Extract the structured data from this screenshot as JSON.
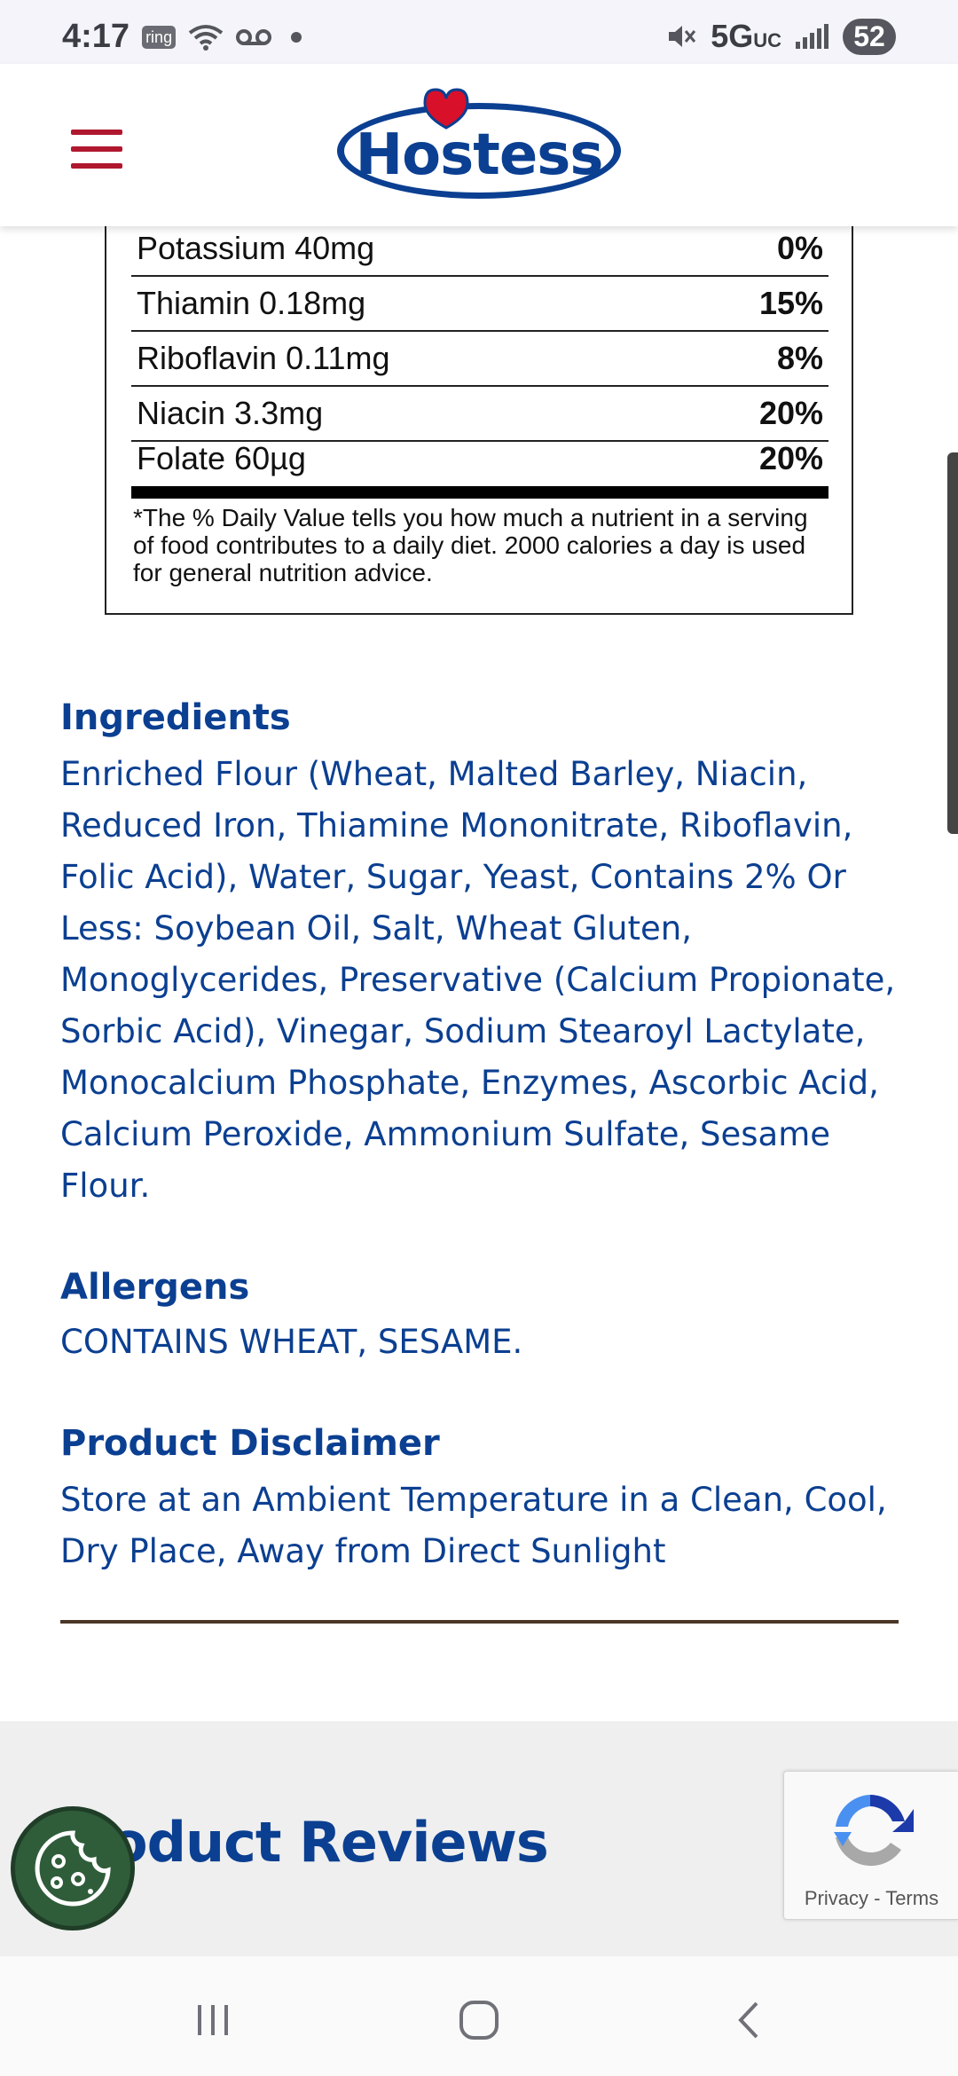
{
  "status_bar": {
    "time": "4:17",
    "ring_label": "ring",
    "network": "5G",
    "network_suffix": "UC",
    "battery": "52"
  },
  "header": {
    "logo_text": "Hostess"
  },
  "nutrition": {
    "rows": [
      {
        "nutrient": "Potassium 40mg",
        "dv": "0%"
      },
      {
        "nutrient": "Thiamin 0.18mg",
        "dv": "15%"
      },
      {
        "nutrient": "Riboflavin 0.11mg",
        "dv": "8%"
      },
      {
        "nutrient": "Niacin 3.3mg",
        "dv": "20%"
      },
      {
        "nutrient": "Folate 60µg",
        "dv": "20%"
      }
    ],
    "footnote": "*The % Daily Value tells you how much a nutrient in a serving of food contributes to a daily diet. 2000 calories a day is used for general nutrition advice."
  },
  "ingredients": {
    "title": "Ingredients",
    "text": "Enriched Flour (Wheat, Malted Barley, Niacin, Reduced Iron, Thiamine Mononitrate, Riboflavin, Folic Acid), Water, Sugar, Yeast, Contains 2% Or Less: Soybean Oil, Salt, Wheat Gluten, Monoglycerides, Preservative (Calcium Propionate, Sorbic Acid), Vinegar, Sodium Stearoyl Lactylate, Monocalcium Phosphate, Enzymes, Ascorbic Acid, Calcium Peroxide, Ammonium Sulfate, Sesame Flour."
  },
  "allergens": {
    "title": "Allergens",
    "text": "CONTAINS WHEAT, SESAME."
  },
  "disclaimer": {
    "title": "Product Disclaimer",
    "text": "Store at an Ambient Temperature in a Clean, Cool, Dry Place, Away from Direct Sunlight"
  },
  "reviews": {
    "title": "oduct Reviews"
  },
  "recaptcha": {
    "privacy": "Privacy",
    "separator": " - ",
    "terms": "Terms"
  },
  "colors": {
    "brand_blue": "#0b3f91",
    "brand_red": "#b0182f",
    "cookie_green": "#2f5d3a"
  },
  "icons": [
    "menu-icon",
    "wifi-icon",
    "voicemail-icon",
    "mute-icon",
    "signal-icon",
    "cookie-icon",
    "recaptcha-icon",
    "recents-icon",
    "home-icon",
    "back-icon"
  ]
}
